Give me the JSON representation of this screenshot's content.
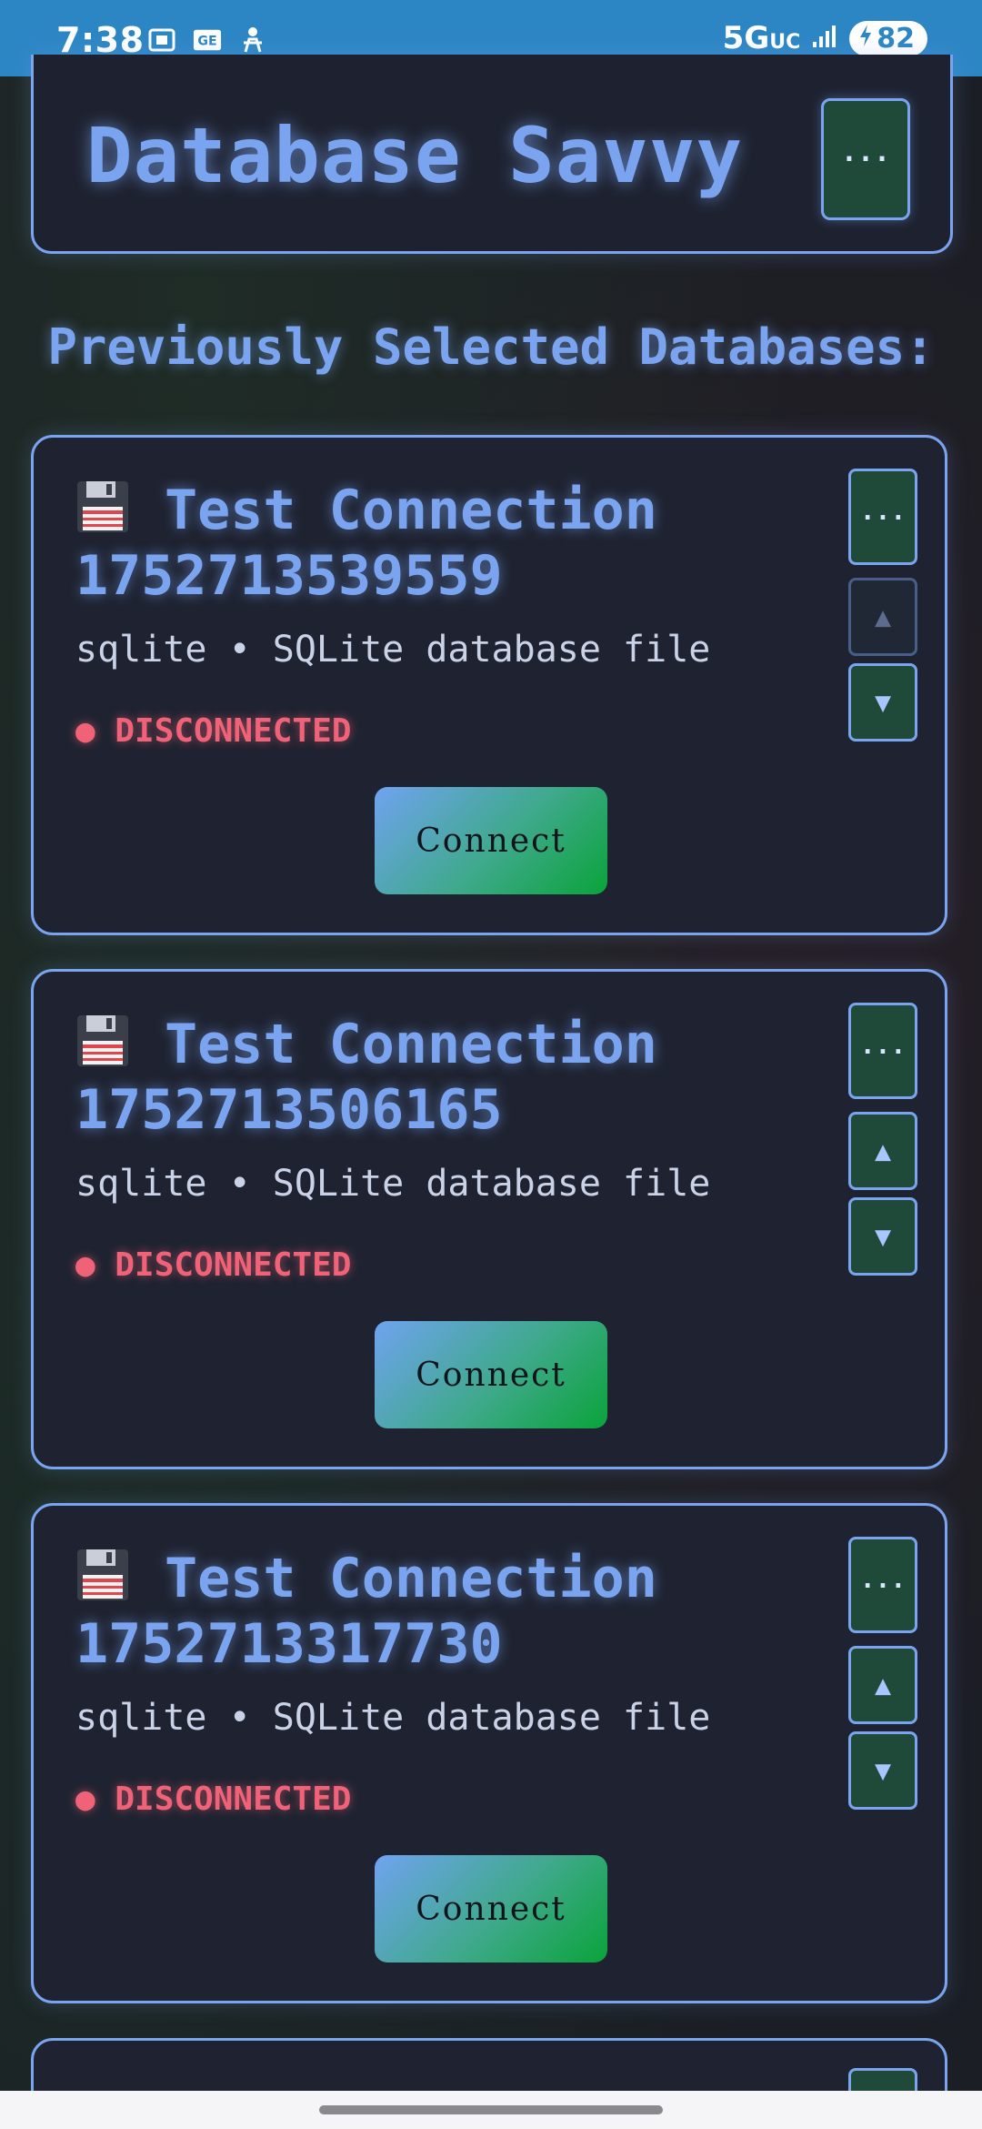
{
  "status_bar": {
    "time": "7:38",
    "network": "5G",
    "network_suffix": "UC",
    "battery": "82",
    "icons": [
      "screenshot-icon",
      "ge-badge-icon",
      "accessibility-icon",
      "signal-icon",
      "charging-icon"
    ]
  },
  "header": {
    "title": "Database Savvy",
    "menu_label": "···"
  },
  "section_title": "Previously Selected Databases:",
  "connections": [
    {
      "title_line1": "Test Connection",
      "title_line2": "1752713539559",
      "meta": "sqlite • SQLite database file",
      "status": "● DISCONNECTED",
      "connect_label": "Connect",
      "more_label": "···",
      "up_label": "▲",
      "down_label": "▼",
      "up_disabled": true
    },
    {
      "title_line1": "Test Connection",
      "title_line2": "1752713506165",
      "meta": "sqlite • SQLite database file",
      "status": "● DISCONNECTED",
      "connect_label": "Connect",
      "more_label": "···",
      "up_label": "▲",
      "down_label": "▼",
      "up_disabled": false
    },
    {
      "title_line1": "Test Connection",
      "title_line2": "1752713317730",
      "meta": "sqlite • SQLite database file",
      "status": "● DISCONNECTED",
      "connect_label": "Connect",
      "more_label": "···",
      "up_label": "▲",
      "down_label": "▼",
      "up_disabled": false
    }
  ],
  "colors": {
    "accent": "#7aa4f0",
    "status_bar": "#2d86c4",
    "disconnected": "#f06278",
    "button_green": "#1f4a3a"
  }
}
